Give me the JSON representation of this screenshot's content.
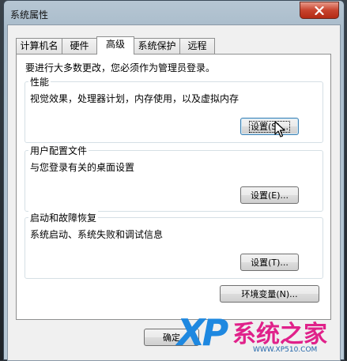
{
  "window": {
    "title": "系统属性"
  },
  "tabs": [
    {
      "label": "计算机名",
      "active": false
    },
    {
      "label": "硬件",
      "active": false
    },
    {
      "label": "高级",
      "active": true
    },
    {
      "label": "系统保护",
      "active": false
    },
    {
      "label": "远程",
      "active": false
    }
  ],
  "panel": {
    "notice": "要进行大多数更改，您必须作为管理员登录。",
    "groups": [
      {
        "title": "性能",
        "description": "视觉效果，处理器计划，内存使用，以及虚拟内存",
        "button": "设置(S)..."
      },
      {
        "title": "用户配置文件",
        "description": "与您登录有关的桌面设置",
        "button": "设置(E)..."
      },
      {
        "title": "启动和故障恢复",
        "description": "系统启动、系统失败和调试信息",
        "button": "设置(T)..."
      }
    ],
    "env_button": "环境变量(N)..."
  },
  "footer": {
    "ok_button": "确定"
  },
  "watermark": {
    "logo": "XP",
    "text": "系统之家",
    "url": "WWW.XP510.COM"
  },
  "colors": {
    "close_button": "#c7432d",
    "watermark_pink": "#e0218a",
    "watermark_blue": "#1e88e0"
  }
}
